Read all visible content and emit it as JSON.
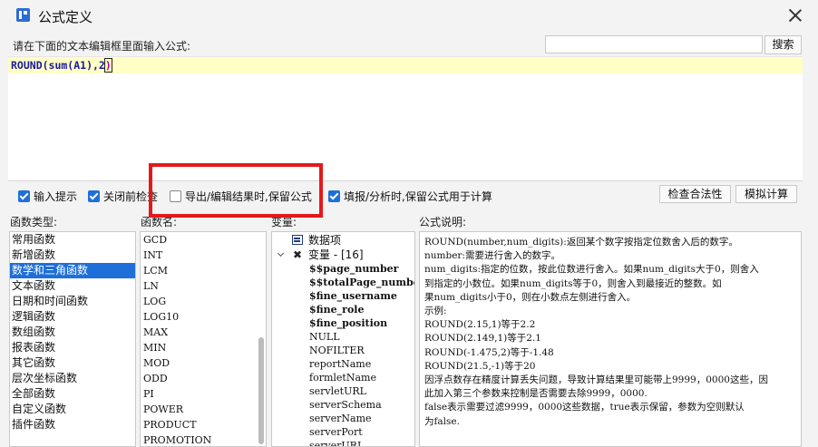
{
  "window": {
    "title": "公式定义"
  },
  "header": {
    "prompt": "请在下面的文本编辑框里面输入公式:",
    "search_value": "",
    "search_button": "搜索"
  },
  "editor": {
    "formula_main": "ROUND(sum(A1),2",
    "formula_close": ")"
  },
  "options": {
    "input_hint": {
      "label": "输入提示",
      "checked": true
    },
    "check_before_close": {
      "label": "关闭前检查",
      "checked": true
    },
    "export_keep_formula": {
      "label": "导出/编辑结果时,保留公式",
      "checked": false
    },
    "fill_keep_formula": {
      "label": "填报/分析时,保留公式用于计算",
      "checked": true
    },
    "check_validity_button": "检查合法性",
    "simulate_button": "模拟计算"
  },
  "columns": {
    "category_label": "函数类型:",
    "function_label": "函数名:",
    "variable_label": "变量:",
    "description_label": "公式说明:"
  },
  "categories": {
    "items": [
      "常用函数",
      "新增函数",
      "数学和三角函数",
      "文本函数",
      "日期和时间函数",
      "逻辑函数",
      "数组函数",
      "报表函数",
      "其它函数",
      "层次坐标函数",
      "全部函数",
      "自定义函数",
      "插件函数"
    ],
    "selected": "数学和三角函数"
  },
  "functions": [
    "GCD",
    "INT",
    "LCM",
    "LN",
    "LOG",
    "LOG10",
    "MAX",
    "MIN",
    "MOD",
    "ODD",
    "PI",
    "POWER",
    "PRODUCT",
    "PROMOTION"
  ],
  "variables": {
    "dataset_node": "数据项",
    "variable_node": "变量 - [16]",
    "items": [
      "$$page_number",
      "$$totalPage_number",
      "$fine_username",
      "$fine_role",
      "$fine_position",
      "NULL",
      "NOFILTER",
      "reportName",
      "formletName",
      "servletURL",
      "serverSchema",
      "serverName",
      "serverPort",
      "serverURL"
    ]
  },
  "description": {
    "lines": [
      "ROUND(number,num_digits):返回某个数字按指定位数舍入后的数字。",
      "number:需要进行舍入的数字。",
      "num_digits:指定的位数，按此位数进行舍入。如果num_digits大于0，则舍入",
      "到指定的小数位。如果num_digits等于0，则舍入到最接近的整数。如",
      "果num_digits小于0，则在小数点左侧进行舍入。",
      "示例:",
      "ROUND(2.15,1)等于2.2",
      "ROUND(2.149,1)等于2.1",
      "ROUND(-1.475,2)等于-1.48",
      "ROUND(21.5,-1)等于20",
      "因浮点数存在精度计算丢失问题，导致计算结果里可能带上9999，0000这些，因",
      "此加入第三个参数来控制是否需要去除9999，0000.",
      "false表示需要过滤9999，0000这些数据，true表示保留，参数为空则默认",
      "为false."
    ]
  }
}
